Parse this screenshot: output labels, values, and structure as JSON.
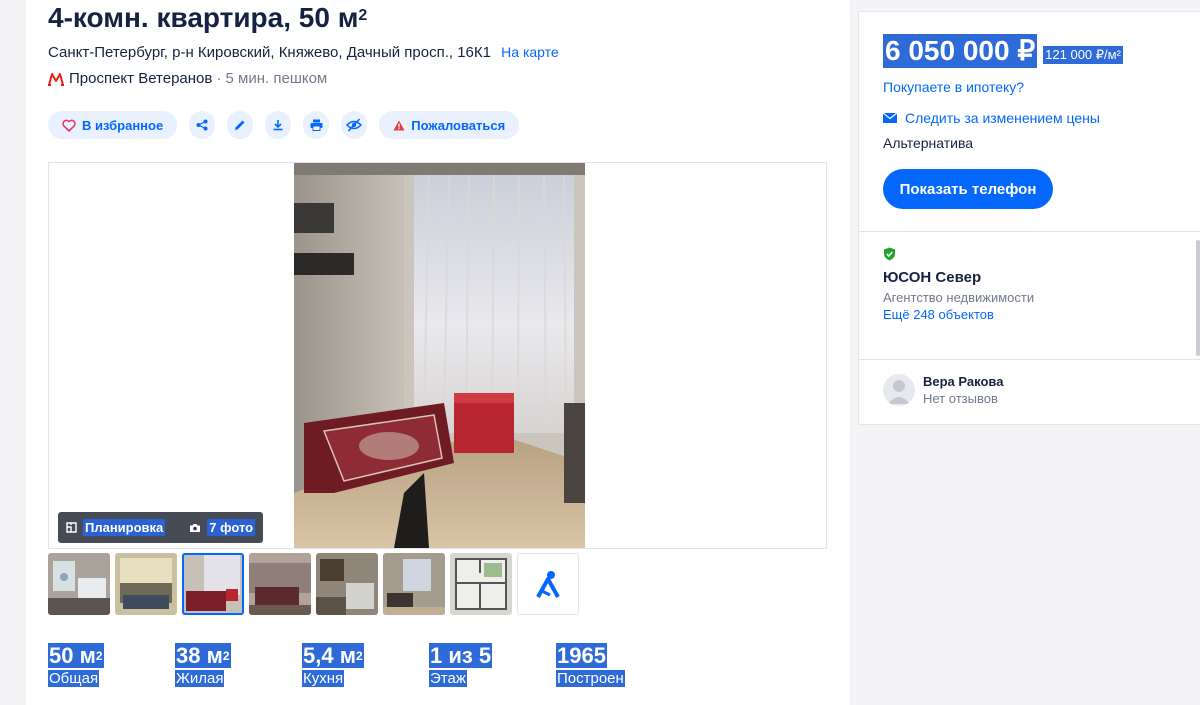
{
  "listing": {
    "title": "4-комн. квартира, 50 м",
    "title_sup": "2",
    "address": "Санкт-Петербург, р-н Кировский, Княжево, Дачный просп., 16К1",
    "map_link": "На карте",
    "metro_station": "Проспект Ветеранов",
    "metro_walk": "· 5 мин. пешком",
    "metro_color": "#e42313"
  },
  "actions": {
    "favorite": "В избранное",
    "share_icon": "share-icon",
    "edit_icon": "pencil-icon",
    "download_icon": "download-icon",
    "print_icon": "printer-icon",
    "hide_icon": "eye-off-icon",
    "complain": "Пожаловаться"
  },
  "gallery": {
    "plan_label": "Планировка",
    "photo_count": "7 фото",
    "thumbnails": [
      "bathroom",
      "living-room",
      "bedroom-carpet",
      "sofa-room",
      "kitchen",
      "window-room",
      "floor-plan",
      "cian-logo"
    ],
    "active_thumbnail": 2
  },
  "stats": [
    {
      "value": "50 м",
      "sup": "2",
      "label": "Общая"
    },
    {
      "value": "38 м",
      "sup": "2",
      "label": "Жилая"
    },
    {
      "value": "5,4 м",
      "sup": "2",
      "label": "Кухня"
    },
    {
      "value": "1 из 5",
      "sup": "",
      "label": "Этаж"
    },
    {
      "value": "1965",
      "sup": "",
      "label": "Построен"
    }
  ],
  "sidebar": {
    "price": "6 050 000 ₽",
    "price_per_m2": "121 000 ₽/м²",
    "mortgage_link": "Покупаете в ипотеку?",
    "follow_price": "Следить за изменением цены",
    "alternative": "Альтернатива",
    "show_phone": "Показать телефон",
    "agency_name": "ЮСОН Север",
    "agency_type": "Агентство недвижимости",
    "agency_more": "Ещё 248 объектов",
    "agent_name": "Вера Ракова",
    "agent_reviews": "Нет отзывов"
  },
  "colors": {
    "accent": "#0468ff",
    "selection": "#2e6bd9",
    "verified": "#21a427"
  }
}
